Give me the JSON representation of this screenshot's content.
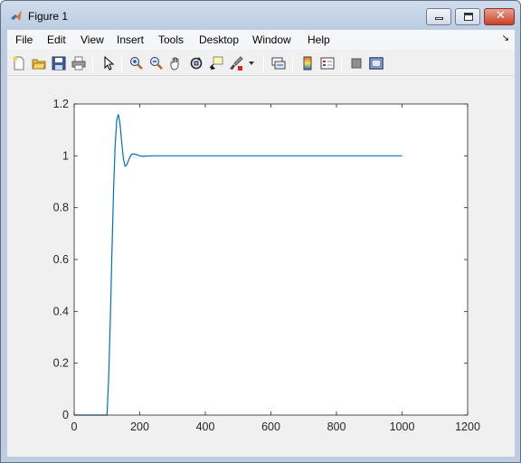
{
  "window": {
    "title": "Figure 1"
  },
  "menu": {
    "items": [
      "File",
      "Edit",
      "View",
      "Insert",
      "Tools",
      "Desktop",
      "Window",
      "Help"
    ]
  },
  "toolbar": {
    "buttons": [
      "new-figure-icon",
      "open-file-icon",
      "save-icon",
      "print-icon",
      "edit-plot-arrow-icon",
      "zoom-in-icon",
      "zoom-out-icon",
      "pan-hand-icon",
      "rotate-3d-icon",
      "data-cursor-icon",
      "brush-icon",
      "link-plot-icon",
      "insert-colorbar-icon",
      "insert-legend-icon",
      "hide-plot-tools-icon",
      "show-plot-tools-icon"
    ]
  },
  "colors": {
    "line": "#0072bd",
    "axes_bg": "#ffffff",
    "figure_bg": "#f0f0f0"
  },
  "chart_data": {
    "type": "line",
    "title": "",
    "xlabel": "",
    "ylabel": "",
    "xlim": [
      0,
      1200
    ],
    "ylim": [
      0,
      1.2
    ],
    "xticks": [
      "0",
      "200",
      "400",
      "600",
      "800",
      "1000",
      "1200"
    ],
    "yticks": [
      "0",
      "0.2",
      "0.4",
      "0.6",
      "0.8",
      "1",
      "1.2"
    ],
    "grid": false,
    "series": [
      {
        "x": [
          0,
          100,
          105,
          110,
          115,
          120,
          125,
          130,
          135,
          140,
          145,
          150,
          155,
          160,
          165,
          170,
          175,
          180,
          190,
          200,
          210,
          220,
          240,
          260,
          300,
          400,
          600,
          800,
          1000
        ],
        "y": [
          0,
          0,
          0.14,
          0.36,
          0.62,
          0.86,
          1.04,
          1.14,
          1.16,
          1.12,
          1.05,
          0.99,
          0.96,
          0.965,
          0.98,
          0.995,
          1.005,
          1.008,
          1.005,
          1.0,
          0.998,
          0.999,
          1.0,
          1.0,
          1.0,
          1.0,
          1.0,
          1.0,
          1.0
        ]
      }
    ]
  }
}
